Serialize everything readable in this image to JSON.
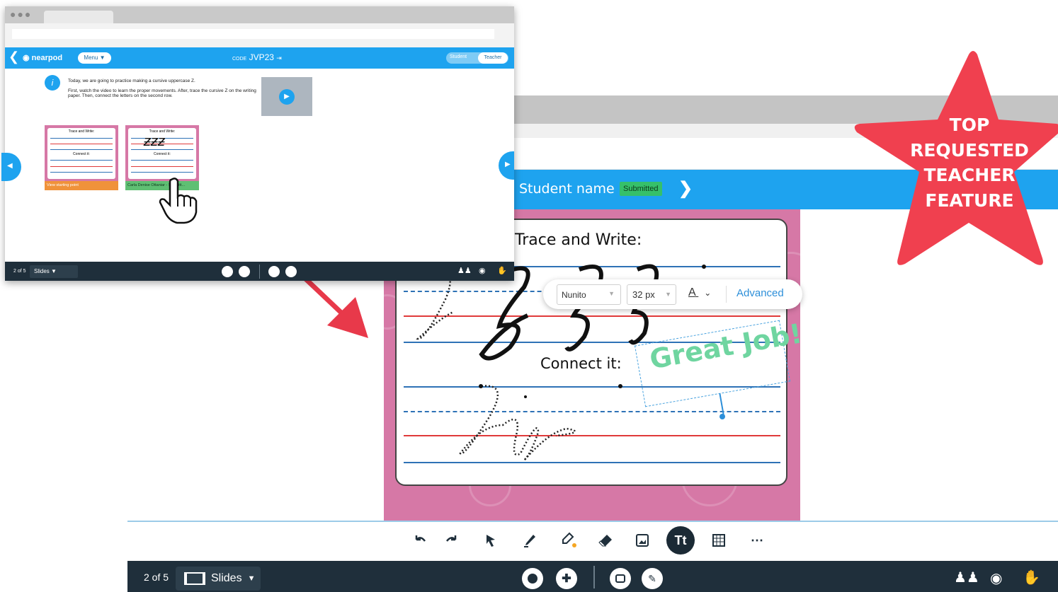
{
  "front_window": {
    "code_label": "CODE",
    "code_value": "JVP23",
    "menu_label": "Menu ▼",
    "logo_text": "nearpod",
    "toggle_student": "Student",
    "toggle_teacher": "Teacher",
    "instruction_line1": "Today, we are going to practice making a cursive uppercase Z.",
    "instruction_line2": "First, watch the video to learn the proper movements. After, trace the cursive Z on the writing paper. Then, connect the letters on the second row.",
    "card1_title": "Trace and Write:",
    "card1_subtitle": "Connect it:",
    "card1_label": "View starting point",
    "card2_title": "Trace and Write:",
    "card2_subtitle": "Connect it:",
    "card2_label": "Carla Denise Ottaniar - Submitt...",
    "page_indicator": "2 of 5",
    "slides_label": "Slides ▼"
  },
  "back_window": {
    "student_name": "Student name",
    "status_badge": "Submitted",
    "worksheet_title": "Trace and Write:",
    "worksheet_subtitle": "Connect it:",
    "text_toolbar": {
      "font": "Nunito",
      "size": "32 px",
      "color_glyph": "A",
      "advanced": "Advanced"
    },
    "annotation_text": "Great Job!",
    "page_indicator": "2 of 5",
    "slides_label": "Slides",
    "tools": [
      "undo-icon",
      "redo-icon",
      "select-icon",
      "pen-icon",
      "highlighter-icon",
      "eraser-icon",
      "image-icon",
      "text-tool-icon",
      "grid-icon",
      "more-icon"
    ],
    "text_tool_label": "Tt"
  },
  "badge": {
    "line1": "TOP",
    "line2": "REQUESTED",
    "line3": "TEACHER",
    "line4": "FEATURE"
  },
  "colors": {
    "nearpod_blue": "#1ea3ef",
    "dark_bar": "#1f2f3b",
    "board_pink": "#d678a6",
    "star_red": "#f0404f",
    "arrow_red": "#e8394a",
    "great_job_green": "#6fd5a0"
  }
}
